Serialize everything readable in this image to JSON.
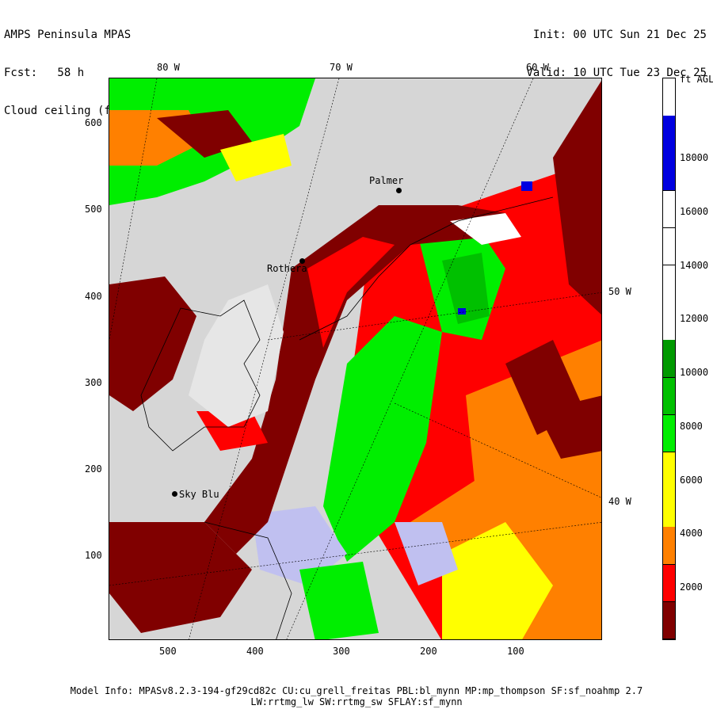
{
  "header": {
    "title": "AMPS Peninsula MPAS",
    "forecast": "Fcst:   58 h",
    "field": "Cloud ceiling (ft AGL)",
    "init": "Init: 00 UTC Sun 21 Dec 25",
    "valid": "Valid: 10 UTC Tue 23 Dec 25"
  },
  "axes": {
    "y_ticks": [
      "600",
      "500",
      "400",
      "300",
      "200",
      "100"
    ],
    "x_ticks": [
      "500",
      "400",
      "300",
      "200",
      "100"
    ],
    "top_lon_labels": [
      "80 W",
      "70 W",
      "60 W"
    ],
    "right_lon_labels": [
      "50 W",
      "40 W"
    ]
  },
  "stations": [
    {
      "name": "Palmer"
    },
    {
      "name": "Rothera"
    },
    {
      "name": "Sky Blu"
    }
  ],
  "colorbar": {
    "unit_label": "ft AGL",
    "tick_labels": [
      "18000",
      "16000",
      "14000",
      "12000",
      "10000",
      "8000",
      "6000",
      "4000",
      "2000"
    ],
    "colors": [
      "#ffffff",
      "#0000e0",
      "#0000e0",
      "#ffffff",
      "#ffffff",
      "#ffffff",
      "#ffffff",
      "#009900",
      "#00c000",
      "#00ee00",
      "#ffff00",
      "#ffff00",
      "#ff8000",
      "#ff0000",
      "#800000"
    ]
  },
  "palette": {
    "land": "#d6d6d6",
    "low_ceiling": "#800000",
    "ceiling_2000": "#ff0000",
    "ceiling_3000": "#ff8000",
    "ceiling_4000": "#ffff00",
    "ceiling_6000": "#00ee00",
    "ceiling_8000": "#00c000",
    "no_ceiling": "#c0c0f0"
  },
  "footer": {
    "line1": "Model Info: MPASv8.2.3-194-gf29cd82c CU:cu_grell_freitas PBL:bl_mynn MP:mp_thompson SF:sf_noahmp 2.7",
    "line2": "LW:rrtmg_lw SW:rrtmg_sw SFLAY:sf_mynn"
  }
}
